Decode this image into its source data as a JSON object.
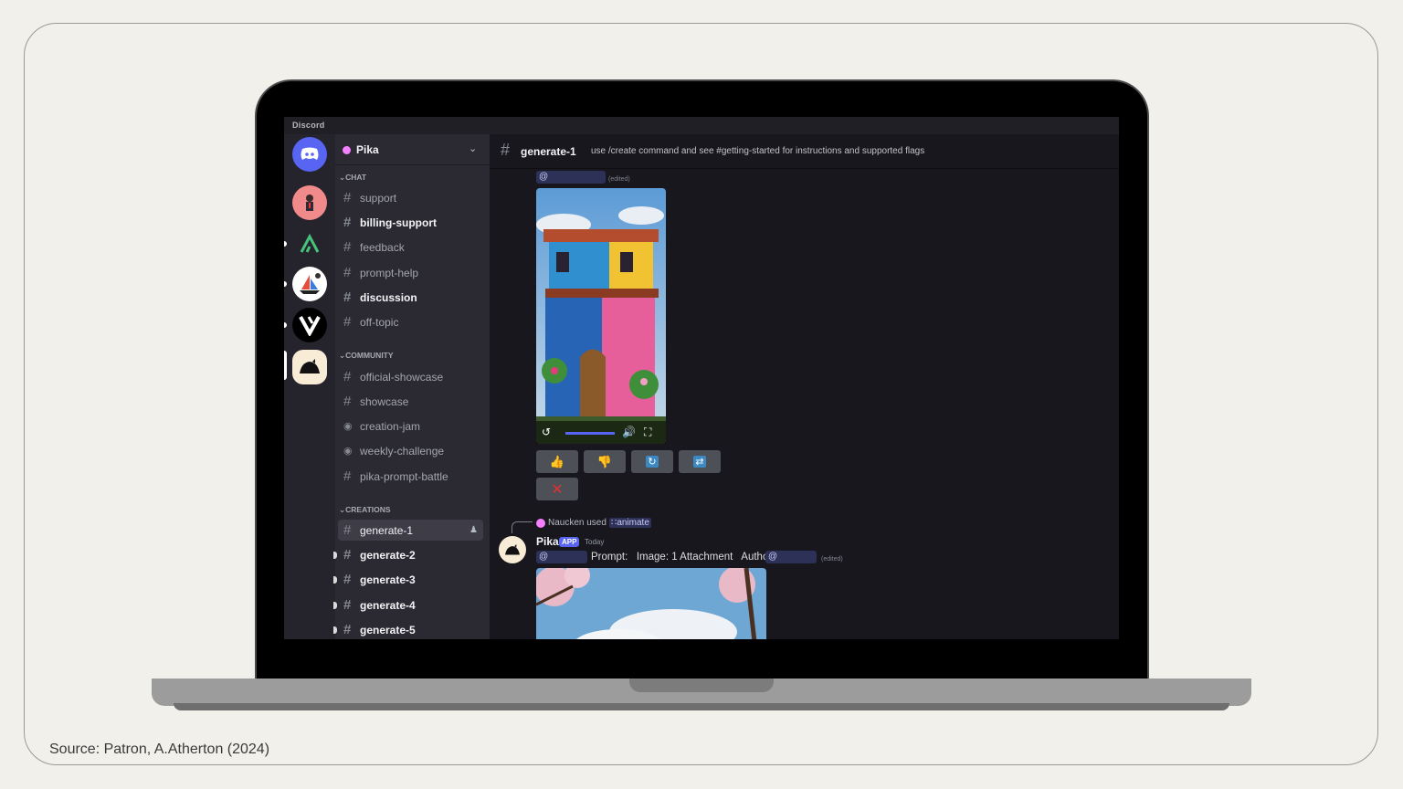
{
  "caption": "Source: Patron, A.Atherton (2024)",
  "app": {
    "title": "Discord"
  },
  "server": {
    "name": "Pika"
  },
  "categories": {
    "chat": "CHAT",
    "community": "COMMUNITY",
    "creations": "CREATIONS"
  },
  "channels": {
    "chat": [
      "support",
      "billing-support",
      "feedback",
      "prompt-help",
      "discussion",
      "off-topic"
    ],
    "community": [
      "official-showcase",
      "showcase",
      "creation-jam",
      "weekly-challenge",
      "pika-prompt-battle"
    ],
    "creations": [
      "generate-1",
      "generate-2",
      "generate-3",
      "generate-4",
      "generate-5"
    ]
  },
  "header": {
    "channel": "generate-1",
    "topic": "use /create command and see #getting-started for instructions and supported flags"
  },
  "message1": {
    "mention": "@",
    "edited": "(edited)"
  },
  "reactions": [
    "thumbs-up-icon",
    "thumbs-down-icon",
    "reload-icon",
    "shuffle-icon",
    "close-icon"
  ],
  "message2": {
    "reply_user": "Naucken used",
    "reply_command": "animate",
    "bot_name": "Pika",
    "bot_tag": "APP",
    "time": "Today",
    "mention": "@",
    "prompt_label": "Prompt:",
    "image_label": "Image: 1 Attachment",
    "author_label": "Author:",
    "author_mention": "@",
    "edited": "(edited)"
  },
  "colors": {
    "accent": "#5865f2",
    "mention_bg": "#2d3157",
    "sidebar": "#2b2a33",
    "chat_bg": "#18171d"
  }
}
